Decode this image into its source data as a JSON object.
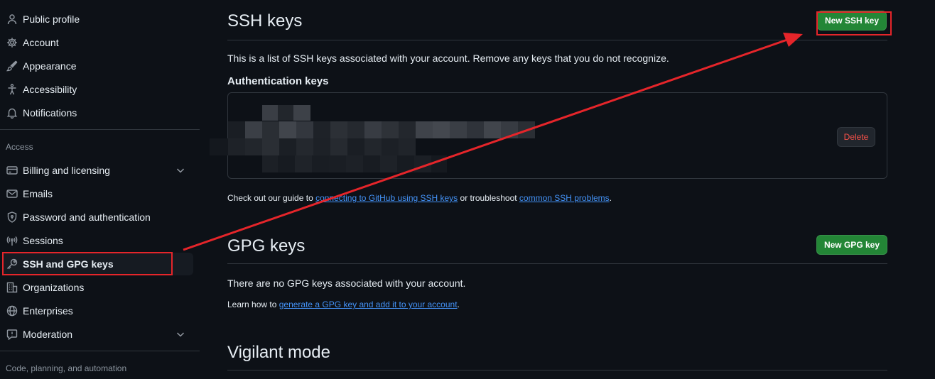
{
  "sidebar": {
    "top_items": [
      {
        "label": "Public profile",
        "icon": "person-icon"
      },
      {
        "label": "Account",
        "icon": "gear-icon"
      },
      {
        "label": "Appearance",
        "icon": "paintbrush-icon"
      },
      {
        "label": "Accessibility",
        "icon": "accessibility-icon"
      },
      {
        "label": "Notifications",
        "icon": "bell-icon"
      }
    ],
    "access_heading": "Access",
    "access_items": [
      {
        "label": "Billing and licensing",
        "icon": "credit-card-icon"
      },
      {
        "label": "Emails",
        "icon": "mail-icon"
      },
      {
        "label": "Password and authentication",
        "icon": "shield-lock-icon"
      },
      {
        "label": "Sessions",
        "icon": "broadcast-icon"
      },
      {
        "label": "SSH and GPG keys",
        "icon": "key-icon"
      },
      {
        "label": "Organizations",
        "icon": "organization-icon"
      },
      {
        "label": "Enterprises",
        "icon": "globe-icon"
      },
      {
        "label": "Moderation",
        "icon": "report-icon"
      }
    ],
    "code_heading": "Code, planning, and automation"
  },
  "ssh": {
    "title": "SSH keys",
    "new_button": "New SSH key",
    "description": "This is a list of SSH keys associated with your account. Remove any keys that you do not recognize.",
    "auth_heading": "Authentication keys",
    "delete_button": "Delete",
    "guide_prefix": "Check out our guide to ",
    "guide_link1": "connecting to GitHub using SSH keys",
    "guide_middle": " or troubleshoot ",
    "guide_link2": "common SSH problems",
    "guide_suffix": "."
  },
  "gpg": {
    "title": "GPG keys",
    "new_button": "New GPG key",
    "empty_text": "There are no GPG keys associated with your account.",
    "learn_prefix": "Learn how to ",
    "learn_link": "generate a GPG key and add it to your account",
    "learn_suffix": "."
  },
  "vigilant": {
    "title": "Vigilant mode"
  },
  "colors": {
    "background": "#0d1117",
    "accent_green": "#238636",
    "link_blue": "#4493f8",
    "danger_red": "#f85149",
    "annotation_red": "#e5252a"
  }
}
